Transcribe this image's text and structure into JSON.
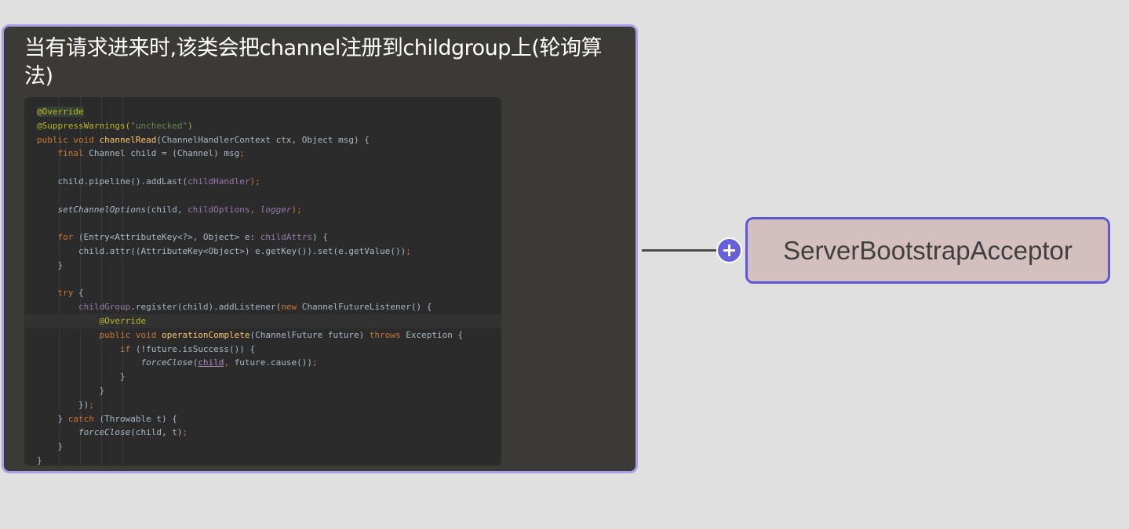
{
  "note": {
    "title": "当有请求进来时,该类会把channel注册到childgroup上(轮询算法)",
    "code_lines": [
      [
        {
          "t": "@Override",
          "c": "#bbb529",
          "bg": "#344134"
        }
      ],
      [
        {
          "t": "@SuppressWarnings(",
          "c": "#bbb529"
        },
        {
          "t": "\"unchecked\"",
          "c": "#6a8759"
        },
        {
          "t": ")",
          "c": "#bbb529"
        }
      ],
      [
        {
          "t": "public void ",
          "c": "#cc7832"
        },
        {
          "t": "channelRead",
          "c": "#ffc66d"
        },
        {
          "t": "(ChannelHandlerContext ctx, Object msg) {",
          "c": "#a9b7c6"
        }
      ],
      [
        {
          "t": "    final ",
          "c": "#cc7832"
        },
        {
          "t": "Channel child = (Channel) msg",
          "c": "#a9b7c6"
        },
        {
          "t": ";",
          "c": "#cc7832"
        }
      ],
      [],
      [
        {
          "t": "    child.pipeline().addLast(",
          "c": "#a9b7c6"
        },
        {
          "t": "childHandler",
          "c": "#9876aa"
        },
        {
          "t": ");",
          "c": "#cc7832"
        }
      ],
      [],
      [
        {
          "t": "    setChannelOptions",
          "c": "#a9b7c6",
          "i": true
        },
        {
          "t": "(child, ",
          "c": "#a9b7c6"
        },
        {
          "t": "childOptions",
          "c": "#9876aa"
        },
        {
          "t": ", ",
          "c": "#cc7832"
        },
        {
          "t": "logger",
          "c": "#9876aa",
          "i": true
        },
        {
          "t": ");",
          "c": "#cc7832"
        }
      ],
      [],
      [
        {
          "t": "    for ",
          "c": "#cc7832"
        },
        {
          "t": "(Entry<AttributeKey<?>, Object> e: ",
          "c": "#a9b7c6"
        },
        {
          "t": "childAttrs",
          "c": "#9876aa"
        },
        {
          "t": ") {",
          "c": "#a9b7c6"
        }
      ],
      [
        {
          "t": "        child.attr((AttributeKey<Object>) e.getKey()).set(e.getValue())",
          "c": "#a9b7c6"
        },
        {
          "t": ";",
          "c": "#cc7832"
        }
      ],
      [
        {
          "t": "    }",
          "c": "#a9b7c6"
        }
      ],
      [],
      [
        {
          "t": "    try ",
          "c": "#cc7832"
        },
        {
          "t": "{",
          "c": "#a9b7c6"
        }
      ],
      [
        {
          "t": "        childGroup",
          "c": "#9876aa"
        },
        {
          "t": ".register(child).addListener(",
          "c": "#a9b7c6"
        },
        {
          "t": "new ",
          "c": "#cc7832"
        },
        {
          "t": "ChannelFutureListener() {",
          "c": "#a9b7c6"
        }
      ],
      [
        {
          "t": "            @Override",
          "c": "#bbb529"
        }
      ],
      [
        {
          "t": "            public void ",
          "c": "#cc7832"
        },
        {
          "t": "operationComplete",
          "c": "#ffc66d"
        },
        {
          "t": "(ChannelFuture future) ",
          "c": "#a9b7c6"
        },
        {
          "t": "throws ",
          "c": "#cc7832"
        },
        {
          "t": "Exception {",
          "c": "#a9b7c6"
        }
      ],
      [
        {
          "t": "                if ",
          "c": "#cc7832"
        },
        {
          "t": "(!future.isSuccess()) {",
          "c": "#a9b7c6"
        }
      ],
      [
        {
          "t": "                    ",
          "c": "#a9b7c6"
        },
        {
          "t": "forceClose",
          "c": "#a9b7c6",
          "i": true
        },
        {
          "t": "(",
          "c": "#a9b7c6"
        },
        {
          "t": "child",
          "c": "#b389c5",
          "u": true
        },
        {
          "t": ", ",
          "c": "#cc7832"
        },
        {
          "t": "future.cause())",
          "c": "#a9b7c6"
        },
        {
          "t": ";",
          "c": "#cc7832"
        }
      ],
      [
        {
          "t": "                }",
          "c": "#a9b7c6"
        }
      ],
      [
        {
          "t": "            }",
          "c": "#a9b7c6"
        }
      ],
      [
        {
          "t": "        })",
          "c": "#a9b7c6"
        },
        {
          "t": ";",
          "c": "#cc7832"
        }
      ],
      [
        {
          "t": "    } ",
          "c": "#a9b7c6"
        },
        {
          "t": "catch ",
          "c": "#cc7832"
        },
        {
          "t": "(Throwable t) {",
          "c": "#a9b7c6"
        }
      ],
      [
        {
          "t": "        forceClose",
          "c": "#a9b7c6",
          "i": true
        },
        {
          "t": "(child, t)",
          "c": "#a9b7c6"
        },
        {
          "t": ";",
          "c": "#cc7832"
        }
      ],
      [
        {
          "t": "    }",
          "c": "#a9b7c6"
        }
      ],
      [
        {
          "t": "}",
          "c": "#a9b7c6"
        }
      ]
    ],
    "highlight_line": 15
  },
  "topic": {
    "label": "ServerBootstrapAcceptor",
    "fill": "#d4bfbf",
    "border": "#5e57d6"
  },
  "expand_button": {
    "icon": "plus-icon",
    "color": "#6661d8"
  },
  "colors": {
    "background": "#e0e0e0",
    "note_background": "#3b3a36",
    "note_border": "#a7a0e6"
  }
}
